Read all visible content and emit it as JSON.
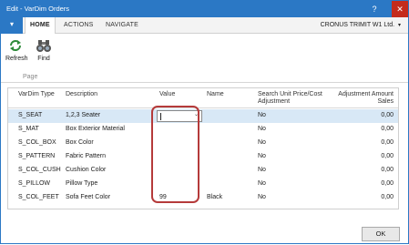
{
  "window": {
    "title": "Edit - VarDim Orders",
    "help_glyph": "?",
    "close_glyph": "✕"
  },
  "menu": {
    "app_button_glyph": "▾",
    "tabs": [
      "HOME",
      "ACTIONS",
      "NAVIGATE"
    ],
    "company": "CRONUS TRIMIT W1 Ltd.",
    "company_caret": "▾"
  },
  "ribbon": {
    "buttons": [
      {
        "label": "Refresh",
        "icon": "refresh-icon"
      },
      {
        "label": "Find",
        "icon": "binoculars-icon"
      }
    ],
    "group_label": "Page"
  },
  "grid": {
    "columns": [
      "VarDim Type",
      "Description",
      "Value",
      "Name",
      "Search Unit Price/Cost Adjustment",
      "Adjustment Amount Sales"
    ],
    "rows": [
      {
        "type": "S_SEAT",
        "description": "1,2,3 Seater",
        "value": "",
        "name": "",
        "search": "No",
        "amount": "0,00",
        "selected": true
      },
      {
        "type": "S_MAT",
        "description": "Box Exterior Material",
        "value": "",
        "name": "",
        "search": "No",
        "amount": "0,00"
      },
      {
        "type": "S_COL_BOX",
        "description": "Box Color",
        "value": "",
        "name": "",
        "search": "No",
        "amount": "0,00"
      },
      {
        "type": "S_PATTERN",
        "description": "Fabric Pattern",
        "value": "",
        "name": "",
        "search": "No",
        "amount": "0,00"
      },
      {
        "type": "S_COL_CUSH",
        "description": "Cushion Color",
        "value": "",
        "name": "",
        "search": "No",
        "amount": "0,00"
      },
      {
        "type": "S_PILLOW",
        "description": "Pillow Type",
        "value": "",
        "name": "",
        "search": "No",
        "amount": "0,00"
      },
      {
        "type": "S_COL_FEET",
        "description": "Sofa Feet Color",
        "value": "99",
        "name": "Black",
        "search": "No",
        "amount": "0,00"
      }
    ]
  },
  "footer": {
    "ok_label": "OK"
  },
  "colors": {
    "accent": "#2b78c5",
    "close": "#c42b1c",
    "highlight": "#b53a3a",
    "selected_row": "#d8e8f6"
  }
}
